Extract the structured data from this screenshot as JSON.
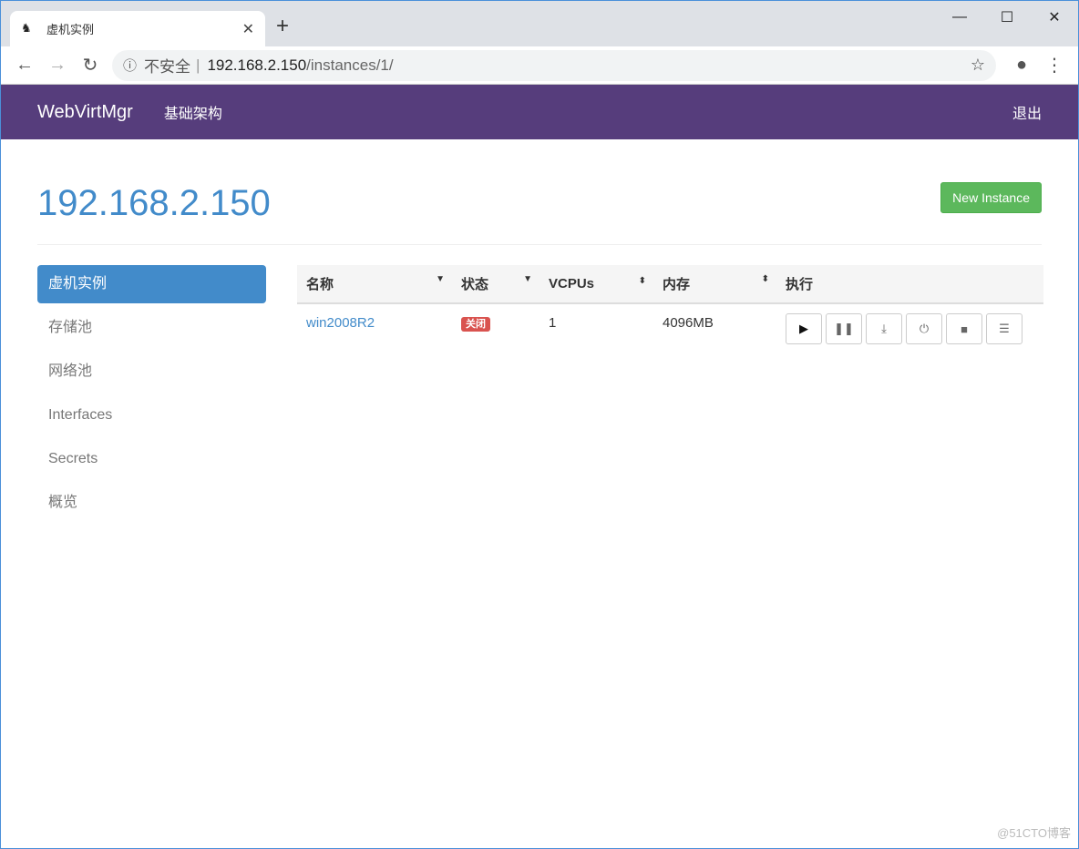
{
  "browser": {
    "tab_title": "虚机实例",
    "insecure": "不安全",
    "url_host": "192.168.2.150",
    "url_path": "/instances/1/"
  },
  "navbar": {
    "brand": "WebVirtMgr",
    "link": "基础架构",
    "logout": "退出"
  },
  "page": {
    "title": "192.168.2.150",
    "new_instance": "New Instance"
  },
  "sidebar": {
    "items": [
      {
        "label": "虚机实例",
        "active": true
      },
      {
        "label": "存储池"
      },
      {
        "label": "网络池"
      },
      {
        "label": "Interfaces"
      },
      {
        "label": "Secrets"
      },
      {
        "label": "概览"
      }
    ]
  },
  "table": {
    "headers": [
      "名称",
      "状态",
      "VCPUs",
      "内存",
      "执行"
    ],
    "rows": [
      {
        "name": "win2008R2",
        "status": "关闭",
        "vcpus": "1",
        "memory": "4096MB"
      }
    ],
    "actions": [
      "play-icon",
      "pause-icon",
      "download-icon",
      "power-icon",
      "stop-icon",
      "list-icon"
    ]
  },
  "colors": {
    "navbar": "#563d7c",
    "accent": "#428bca",
    "success": "#5cb85c",
    "danger": "#d9534f"
  },
  "watermark": "@51CTO博客"
}
